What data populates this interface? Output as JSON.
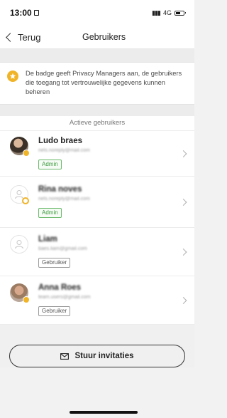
{
  "status_bar": {
    "time": "13:00",
    "network": "4G",
    "signal_icon": "signal-bars-icon",
    "battery_icon": "battery-icon"
  },
  "nav": {
    "back_label": "Terug",
    "title": "Gebruikers",
    "back_icon": "chevron-left-icon"
  },
  "notice": {
    "icon": "star-icon",
    "text": "De badge geeft Privacy Managers aan, de gebruikers die toegang tot vertrouwelijke gegevens kunnen beheren",
    "accent_color": "#f0b428"
  },
  "section": {
    "title": "Actieve gebruikers"
  },
  "users": [
    {
      "name": "Ludo braes",
      "email": "nels.noreply@mail.com",
      "role": "Admin"
    },
    {
      "name": "Rina noves",
      "email": "nels.noreply@mail.com",
      "role": "Admin"
    },
    {
      "name": "Liam",
      "email": "baes.liam@gmail.com",
      "role": "Gebruiker"
    },
    {
      "name": "Anna Roes",
      "email": "team.users@gmail.com",
      "role": "Gebruiker"
    }
  ],
  "invite": {
    "label": "Stuur invitaties",
    "icon": "mail-icon"
  },
  "colors": {
    "admin_tag": "#3e9a3e",
    "badge": "#f0b428"
  }
}
